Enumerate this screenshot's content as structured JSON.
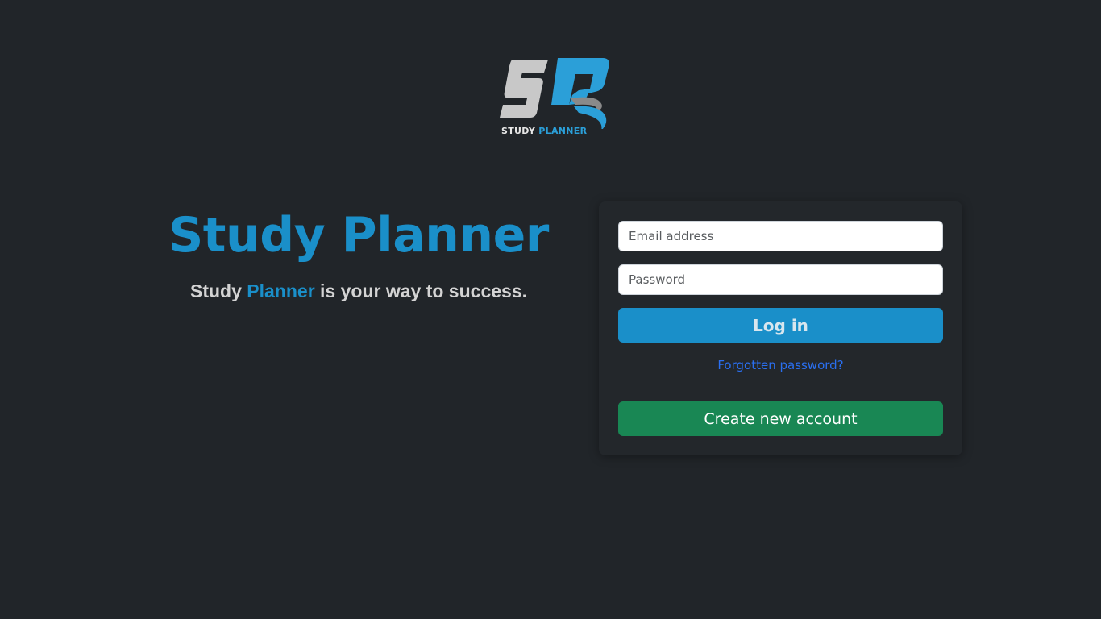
{
  "logo": {
    "caption_word1": "STUDY",
    "caption_word2": "PLANNER",
    "colors": {
      "grey": "#c8c8c8",
      "blue": "#2b9fd8"
    }
  },
  "hero": {
    "title": "Study Planner",
    "tagline_prefix": "Study ",
    "tagline_accent": "Planner",
    "tagline_suffix": " is your way to success."
  },
  "login_form": {
    "email_placeholder": "Email address",
    "email_value": "",
    "password_placeholder": "Password",
    "password_value": "",
    "login_label": "Log in",
    "forgot_label": "Forgotten password?",
    "create_label": "Create new account"
  },
  "colors": {
    "background": "#212529",
    "brand": "#1a8fc9",
    "link": "#2a6ff0",
    "success": "#198754"
  }
}
